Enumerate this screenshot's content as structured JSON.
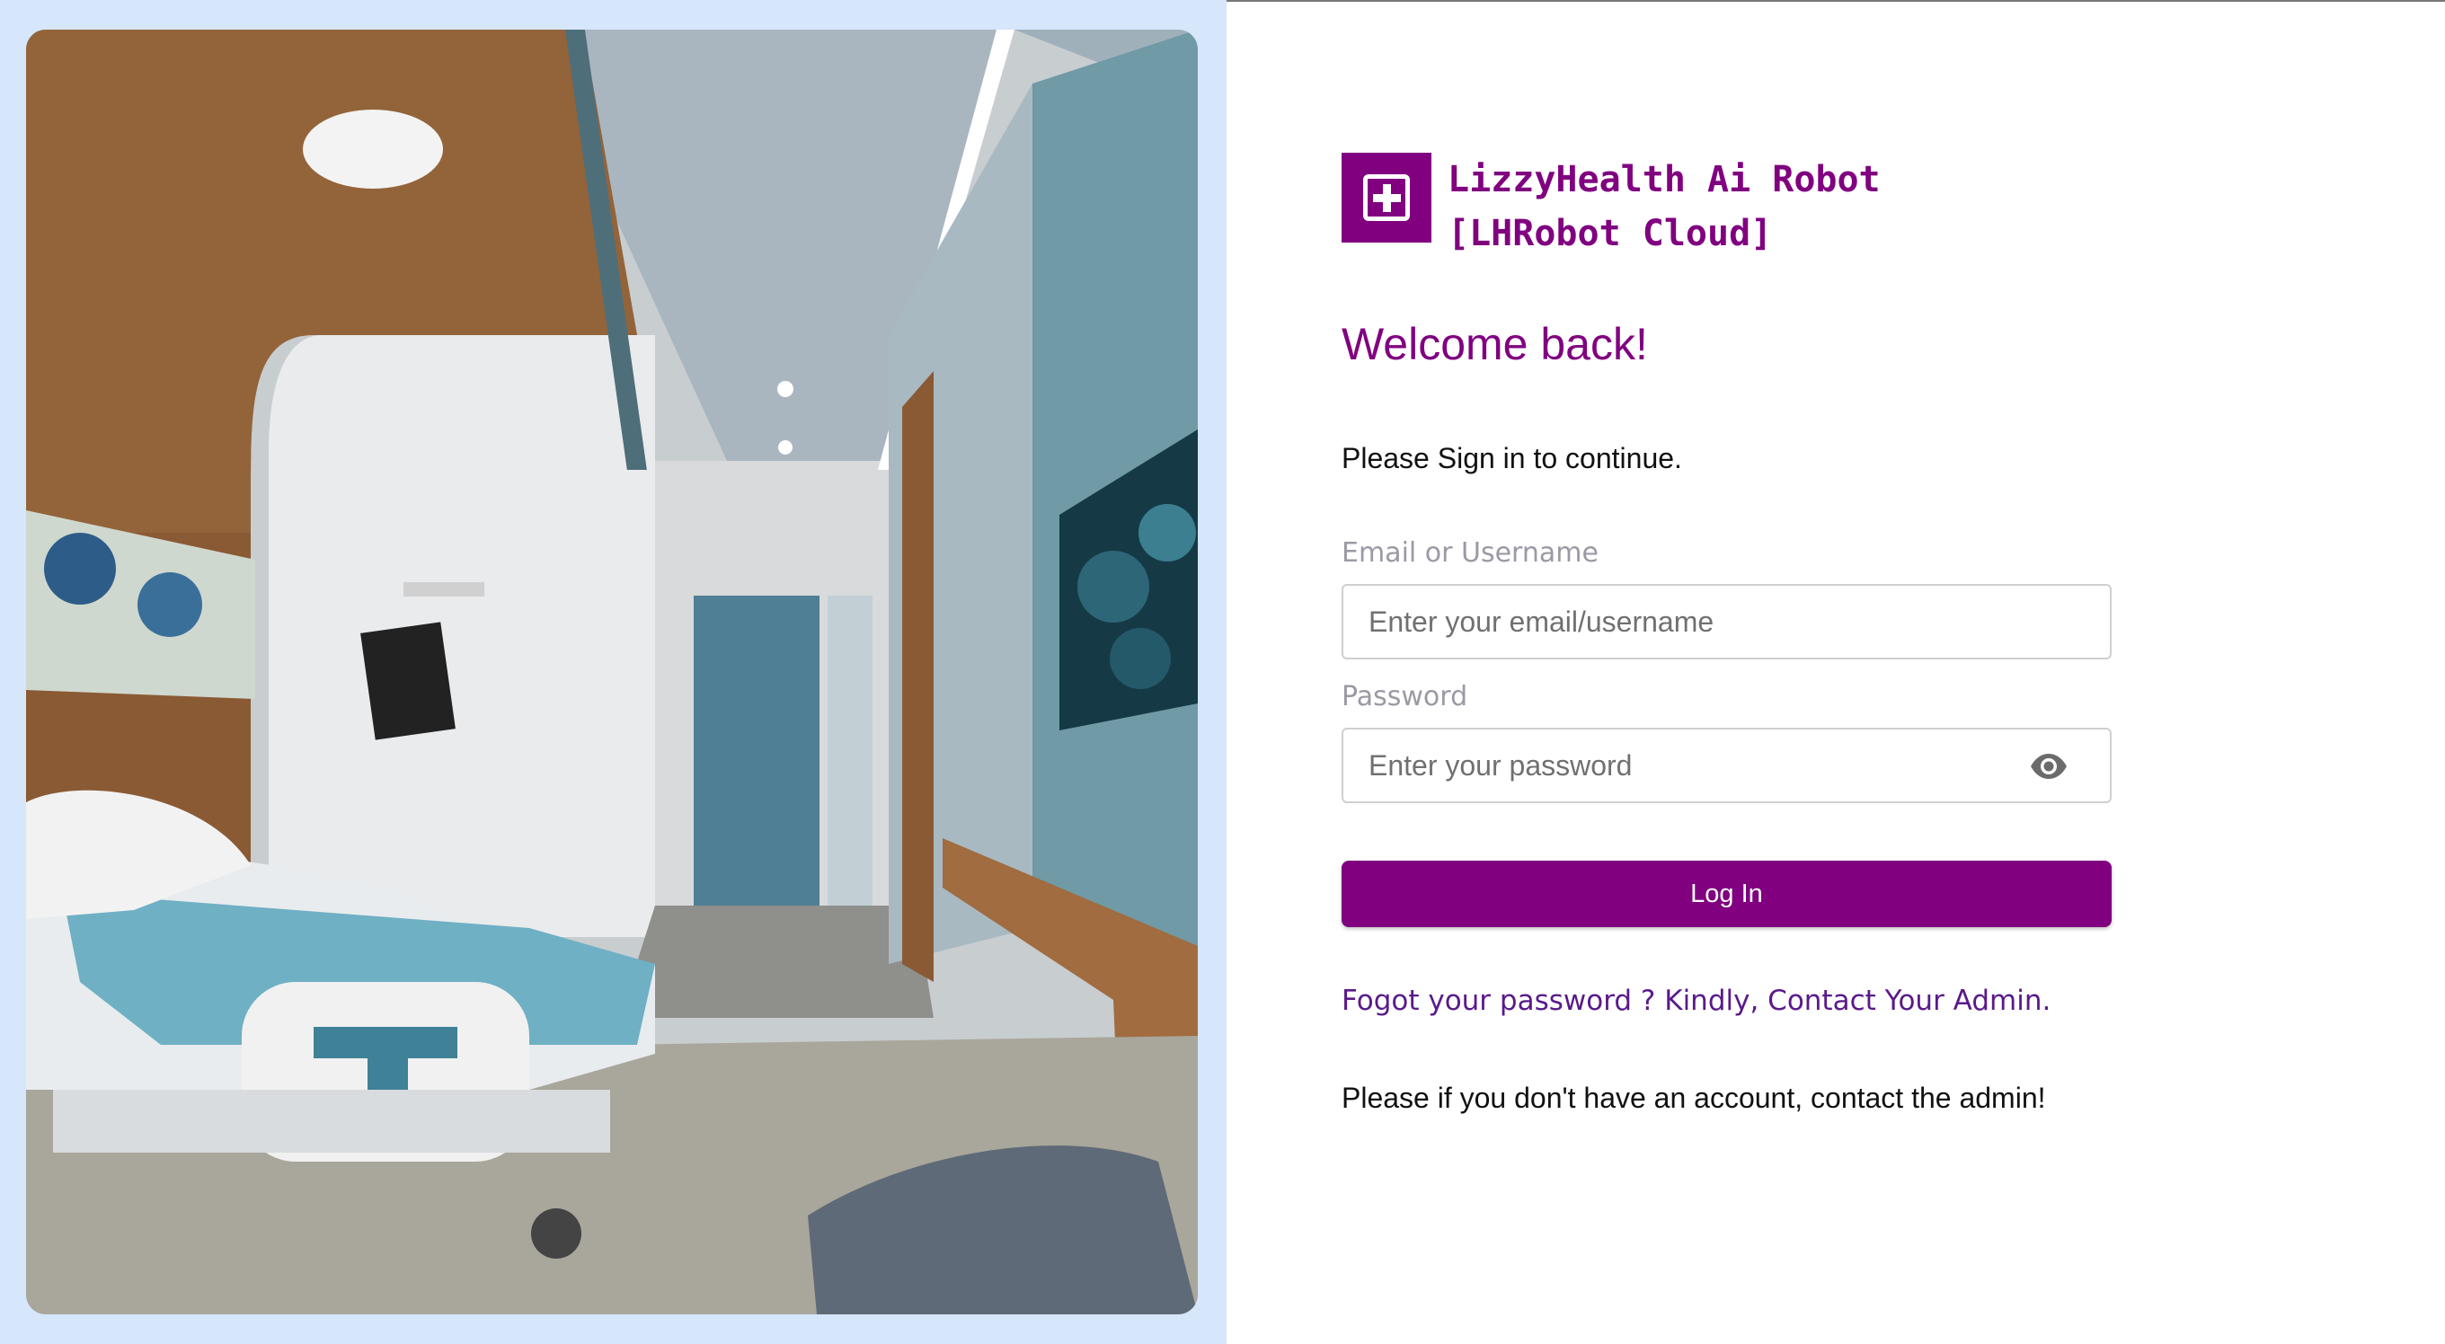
{
  "brand": {
    "name_line1": "LizzyHealth Ai Robot",
    "name_line2": "[LHRobot Cloud]",
    "logo_icon": "medical-cross-icon",
    "color": "#800080"
  },
  "hero": {
    "image": "hospital-room-photo"
  },
  "login": {
    "welcome": "Welcome back!",
    "subtitle": "Please Sign in to continue.",
    "email_label": "Email or Username",
    "email_placeholder": "Enter your email/username",
    "email_value": "",
    "password_label": "Password",
    "password_placeholder": "Enter your password",
    "password_value": "",
    "password_toggle_icon": "eye-icon",
    "submit_label": "Log In",
    "forgot_text": "Fogot your password ? Kindly, Contact Your Admin.",
    "no_account_text": "Please if you don't have an account, contact the admin!"
  },
  "colors": {
    "accent": "#800080",
    "left_background": "#d6e6fb"
  }
}
